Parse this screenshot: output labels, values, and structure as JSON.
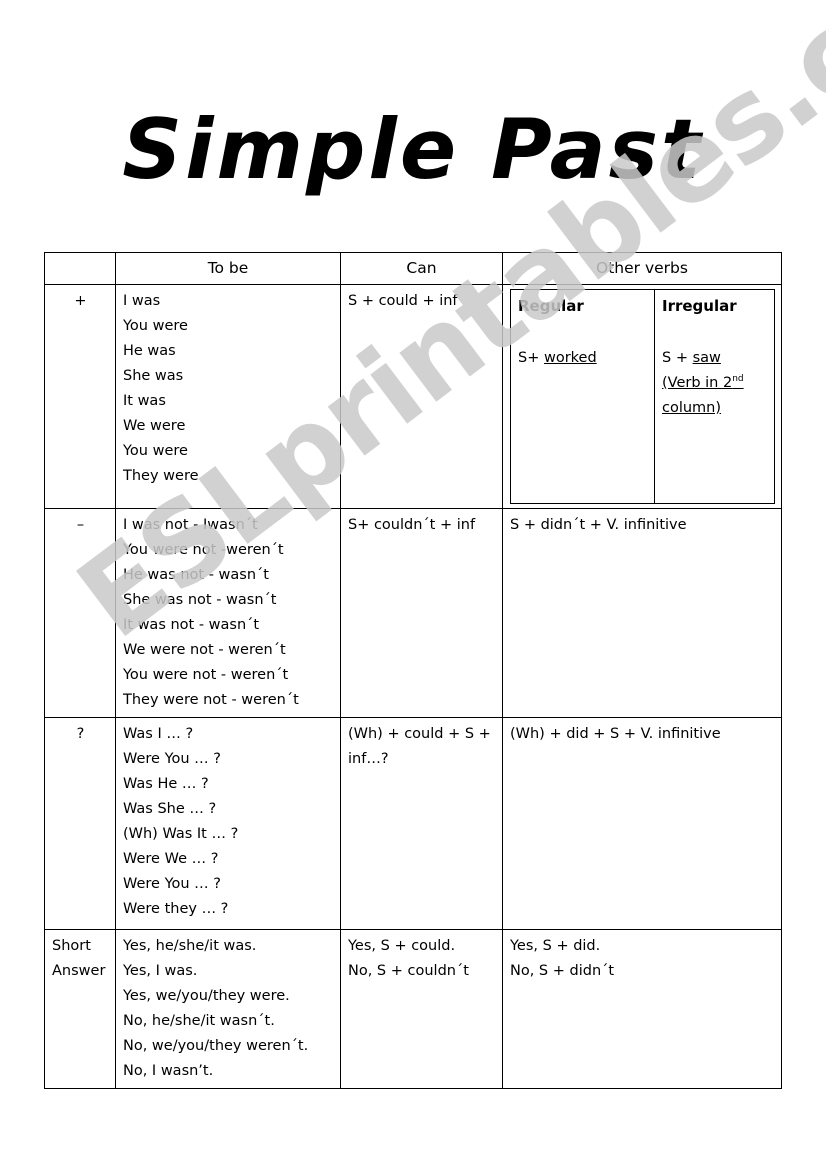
{
  "title": "Simple Past",
  "watermark": "ESLprintables.com",
  "table": {
    "headers": {
      "sign": "",
      "tobe": "To be",
      "can": "Can",
      "other": "Other verbs"
    },
    "subheaders": {
      "regular": "Regular",
      "irregular": "Irregular"
    },
    "rows": [
      {
        "sign": "+",
        "tobe": [
          "I was",
          "You were",
          "He was",
          "She was",
          "It was",
          "We were",
          "You were",
          "They were"
        ],
        "can": [
          "S + could + inf"
        ],
        "regular": [
          "S+ worked"
        ],
        "regular_underline": "worked",
        "irregular": [
          "S + saw",
          "(Verb in 2nd",
          "column)"
        ],
        "irregular_underline": "saw"
      },
      {
        "sign": "–",
        "tobe": [
          "I was not - Iwasn´t",
          "You were not -weren´t",
          "He was not - wasn´t",
          "She was not - wasn´t",
          "It was not - wasn´t",
          "We were not - weren´t",
          "You were not - weren´t",
          "They were not - weren´t"
        ],
        "can": [
          "S+ couldn´t + inf"
        ],
        "other": [
          "S + didn´t + V. infinitive"
        ]
      },
      {
        "sign": "?",
        "tobe": [
          "Was I … ?",
          "Were You … ?",
          "Was He … ?",
          "Was She   … ?",
          "(Wh) Was It … ?",
          "Were We … ?",
          "Were You … ?",
          "Were they … ?"
        ],
        "can": [
          "(Wh) + could + S +",
          "inf…?"
        ],
        "other": [
          "(Wh) + did + S + V. infinitive"
        ]
      },
      {
        "sign": "Short Answer",
        "tobe": [
          "Yes, he/she/it was.",
          "Yes, I was.",
          "Yes, we/you/they were.",
          "No, he/she/it wasn´t.",
          "No, we/you/they weren´t.",
          "No, I wasn’t."
        ],
        "can": [
          "Yes, S + could.",
          "No, S + couldn´t"
        ],
        "other": [
          "Yes, S + did.",
          "No, S + didn´t"
        ]
      }
    ]
  }
}
